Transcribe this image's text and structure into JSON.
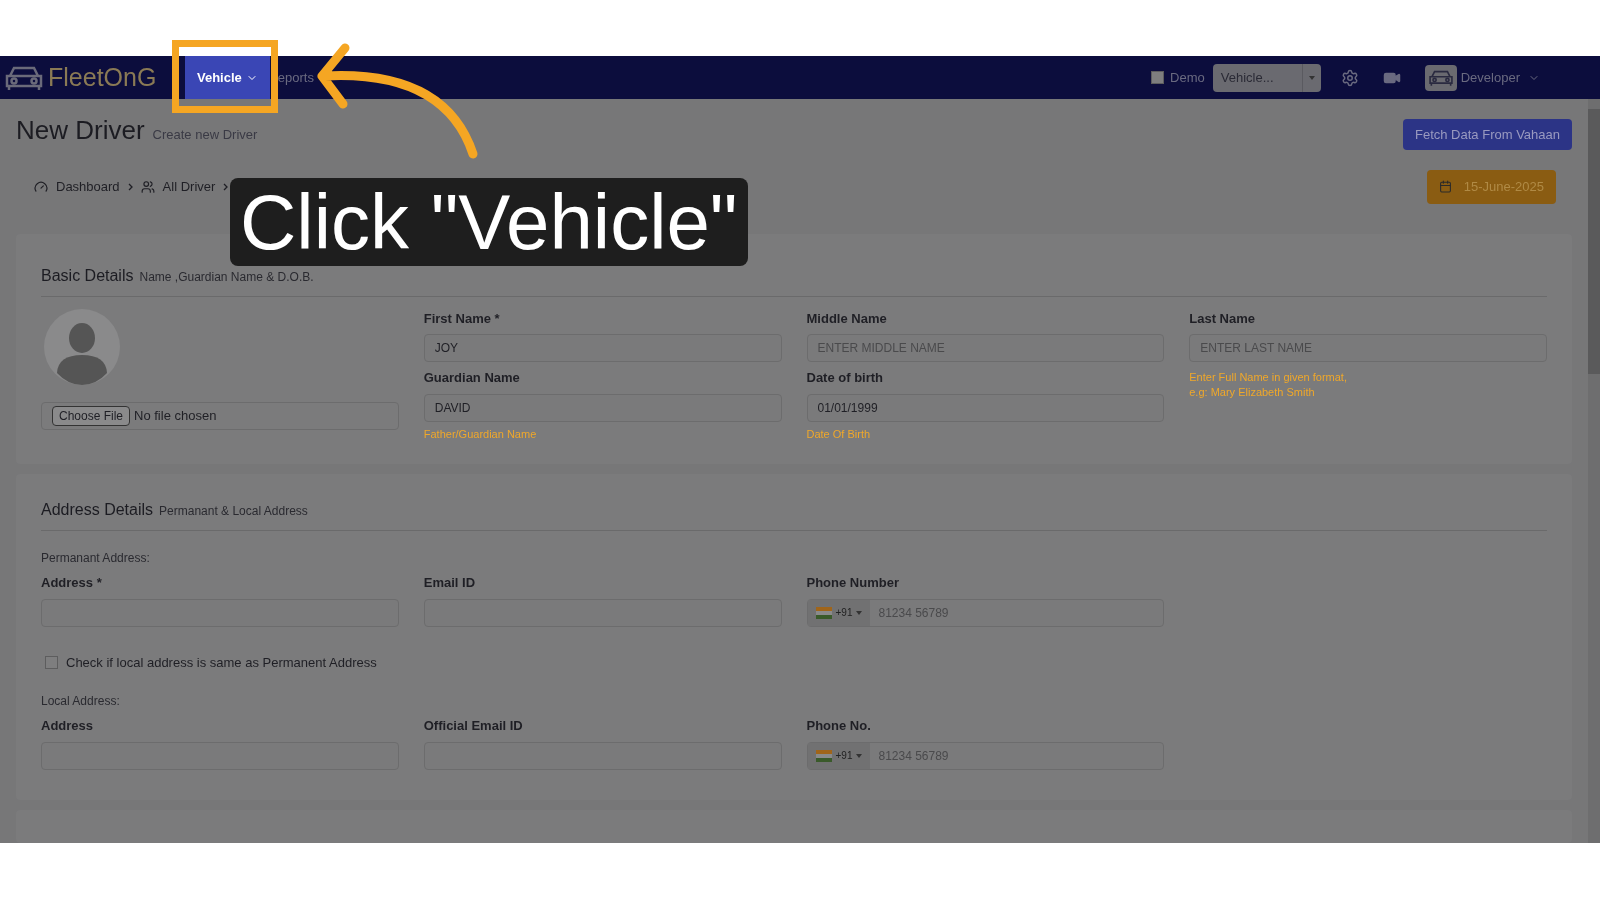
{
  "top_nav": {
    "logo": "FleetOnG",
    "menu": [
      {
        "label": "Vehicle",
        "selected": true
      },
      {
        "label": "eports",
        "selected": false
      }
    ],
    "demo": {
      "label": "Demo",
      "checked": false
    },
    "vehicle_select": {
      "value": "Vehicle..."
    },
    "user": "Developer"
  },
  "header": {
    "title": "New Driver",
    "subtitle": "Create new Driver",
    "fetch_button": "Fetch Data From Vahaan"
  },
  "breadcrumbs": [
    "Dashboard",
    "All Driver"
  ],
  "date_button": "15-June-2025",
  "basic_details": {
    "title": "Basic Details",
    "subtitle": "Name ,Guardian Name & D.O.B.",
    "file": {
      "button": "Choose File",
      "status": "No file chosen"
    },
    "fields": [
      {
        "label": "First Name *",
        "value": "JOY"
      },
      {
        "label": "Middle Name",
        "placeholder": "ENTER MIDDLE NAME"
      },
      {
        "label": "Last Name",
        "placeholder": "ENTER LAST NAME"
      },
      {
        "label": "Guardian Name",
        "value": "DAVID",
        "hint": "Father/Guardian Name"
      },
      {
        "label": "Date of birth",
        "value": "01/01/1999",
        "hint": "Date Of Birth"
      }
    ],
    "note": [
      "Enter Full Name in given format,",
      "e.g: Mary Elizabeth Smith"
    ]
  },
  "address_details": {
    "title": "Address Details",
    "subtitle": "Permanant & Local Address",
    "permanent_label": "Permanant Address:",
    "permanent_fields": [
      {
        "kind": "text",
        "label": "Address *"
      },
      {
        "kind": "text",
        "label": "Email ID"
      },
      {
        "kind": "phone",
        "label": "Phone Number",
        "code": "+91",
        "placeholder": "81234 56789"
      }
    ],
    "same_checkbox": {
      "label": "Check if local address is same as Permanent Address",
      "checked": false
    },
    "local_label": "Local Address:",
    "local_fields": [
      {
        "kind": "text",
        "label": "Address"
      },
      {
        "kind": "text",
        "label": "Official Email ID"
      },
      {
        "kind": "phone",
        "label": "Phone No.",
        "code": "+91",
        "placeholder": "81234 56789"
      }
    ]
  },
  "overlay": {
    "caption": "Click \"Vehicle\""
  }
}
